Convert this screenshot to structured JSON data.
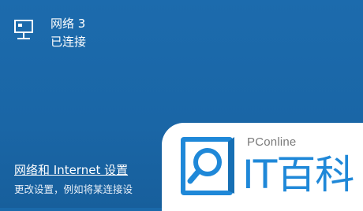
{
  "network": {
    "icon": "ethernet-icon",
    "name": "网络 3",
    "status": "已连接"
  },
  "settings": {
    "link_label": "网络和 Internet 设置",
    "description": "更改设置，例如将某连接设"
  },
  "watermark": {
    "logo_icon": "search-magnifier-logo",
    "brand": "PConline",
    "title": "IT百科",
    "accent": "#1f88d8"
  },
  "colors": {
    "panel_bg": "#1a69aa",
    "text": "#ffffff"
  }
}
